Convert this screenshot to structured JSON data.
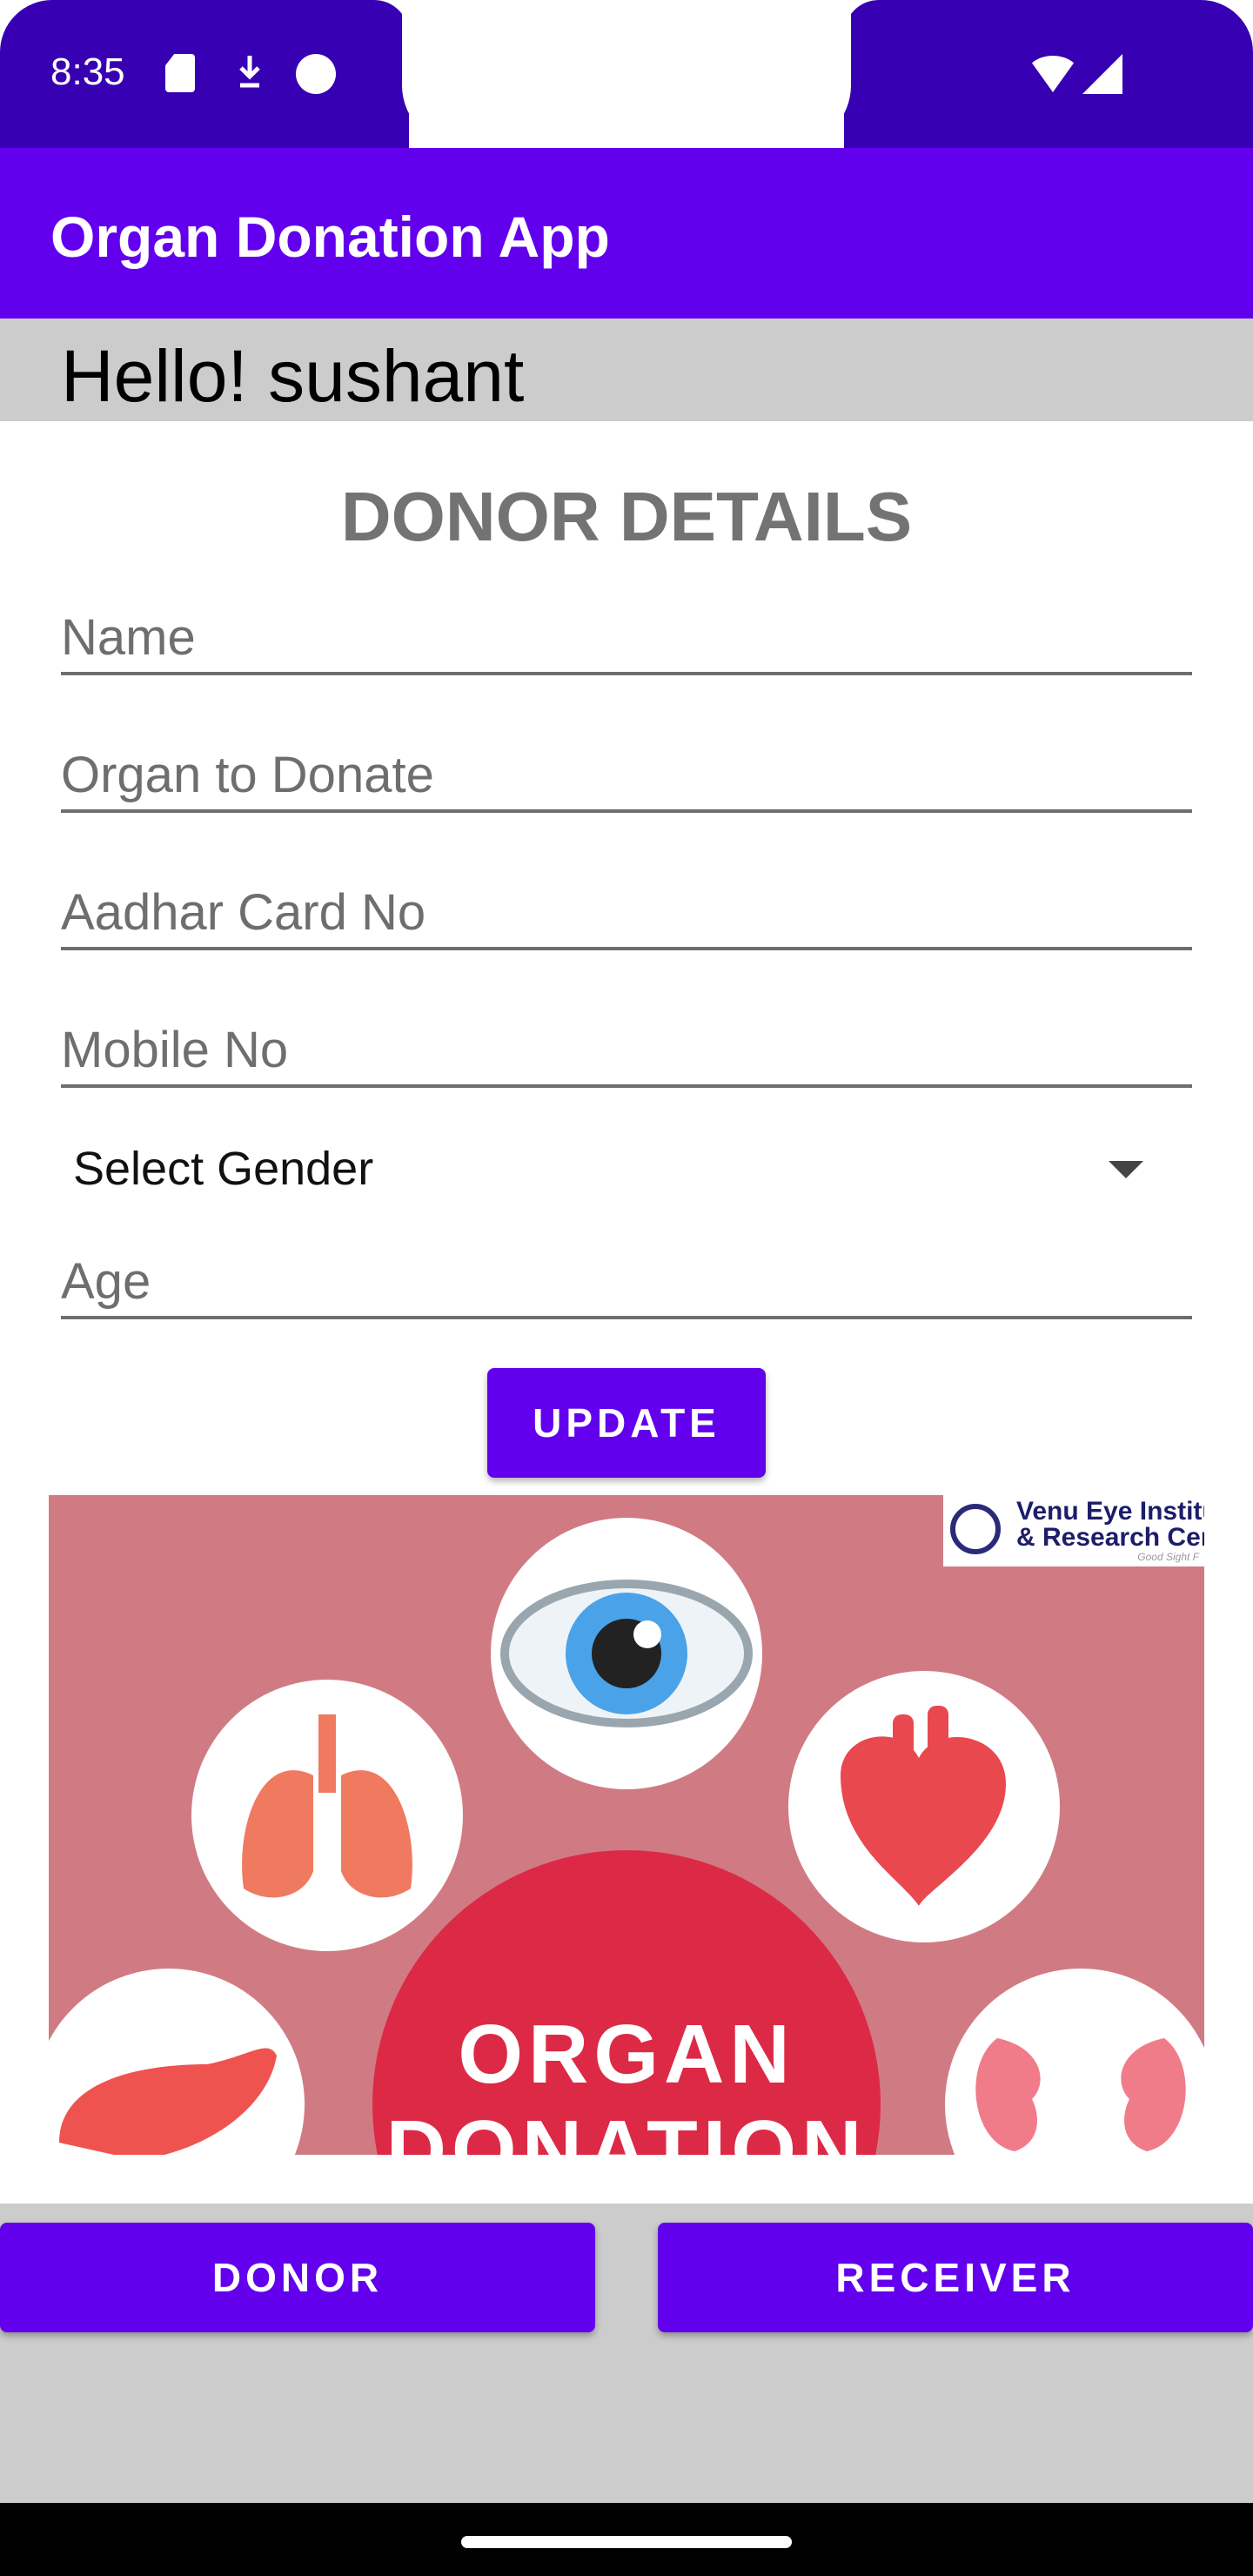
{
  "status_bar": {
    "time": "8:35",
    "icons": [
      "sd-card-icon",
      "download-icon",
      "cat-icon",
      "wifi-icon",
      "signal-icon"
    ]
  },
  "app_bar": {
    "title": "Organ Donation App"
  },
  "greeting": {
    "text": "Hello! sushant"
  },
  "form": {
    "title": "DONOR DETAILS",
    "fields": {
      "name": {
        "placeholder": "Name",
        "value": ""
      },
      "organ": {
        "placeholder": "Organ to Donate",
        "value": ""
      },
      "aadhar": {
        "placeholder": "Aadhar Card No",
        "value": ""
      },
      "mobile": {
        "placeholder": "Mobile No",
        "value": ""
      },
      "age": {
        "placeholder": "Age",
        "value": ""
      }
    },
    "gender_select": {
      "selected": "Select Gender"
    },
    "update_label": "UPDATE"
  },
  "banner": {
    "logo_line1": "Venu Eye Institu",
    "logo_line2": "& Research Cent",
    "logo_tagline": "Good Sight F",
    "headline_line1": "ORGAN",
    "headline_line2": "DONATION",
    "organ_icons": [
      "eye-icon",
      "lungs-icon",
      "heart-icon",
      "liver-icon",
      "kidneys-icon"
    ]
  },
  "bottom_nav": {
    "donor_label": "DONOR",
    "receiver_label": "RECEIVER"
  },
  "colors": {
    "primary": "#6200EE",
    "primary_dark": "#3700B3",
    "banner_bg": "#d07b84",
    "organ_red": "#dc2a46"
  }
}
